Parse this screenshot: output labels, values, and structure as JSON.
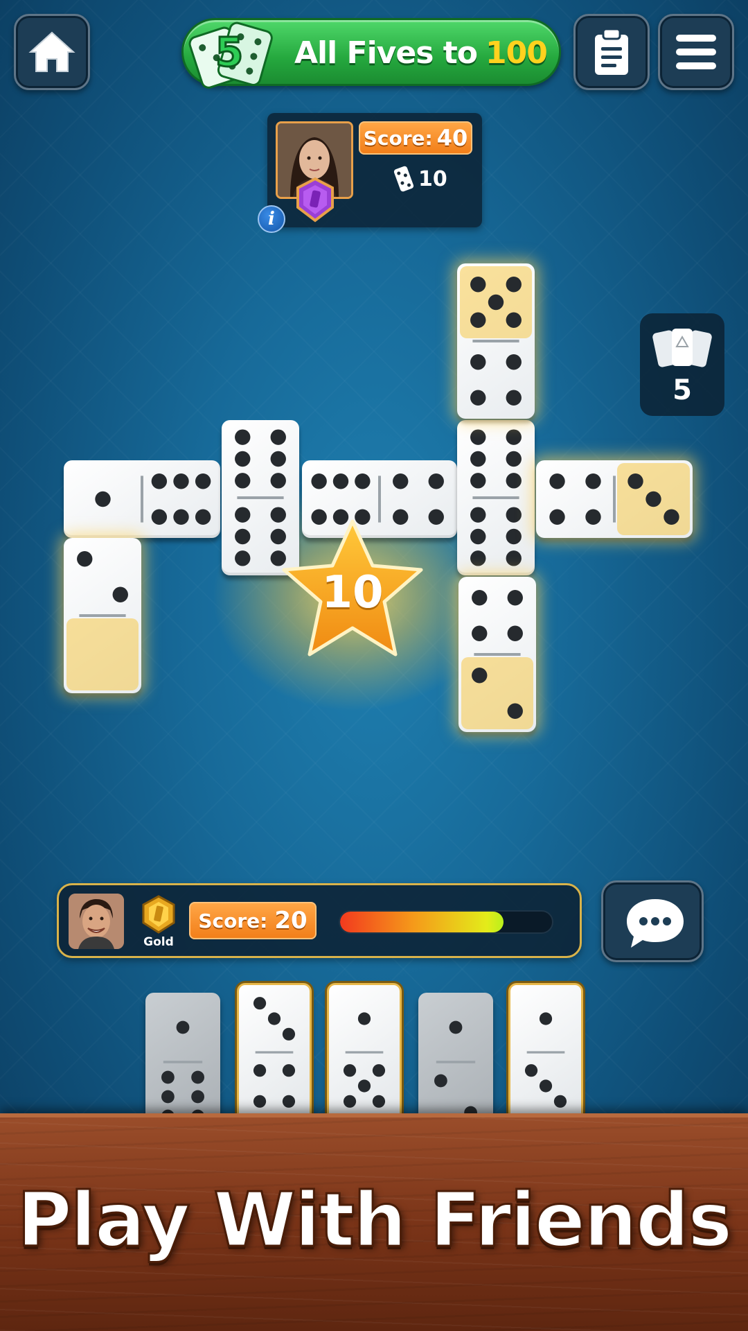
{
  "header": {
    "mode_title": "All Fives to",
    "target_score": "100",
    "logo_badge": "5",
    "home_icon": "home-icon",
    "scores_icon": "clipboard-icon",
    "menu_icon": "hamburger-menu-icon"
  },
  "opponent": {
    "score_label": "Score:",
    "score": "40",
    "tiles_left": "10",
    "rank_badge_icon": "purple-shield-badge-icon",
    "info_icon_text": "i"
  },
  "boneyard": {
    "count": "5",
    "icon": "cards-stack-icon"
  },
  "score_popup": {
    "points": "10"
  },
  "player": {
    "rank": "Gold",
    "score_label": "Score:",
    "score": "20",
    "turn_timer_fraction": 0.77
  },
  "chat": {
    "icon": "chat-bubble-icon"
  },
  "board_tiles": [
    {
      "a": 1,
      "b": 6,
      "orient": "h"
    },
    {
      "a": 2,
      "b": 0,
      "orient": "v",
      "highlight": "b"
    },
    {
      "a": 6,
      "b": 6,
      "orient": "v"
    },
    {
      "a": 6,
      "b": 4,
      "orient": "h"
    },
    {
      "a": 6,
      "b": 6,
      "orient": "v"
    },
    {
      "a": 5,
      "b": 4,
      "orient": "v",
      "highlight": "a"
    },
    {
      "a": 4,
      "b": 2,
      "orient": "v",
      "highlight": "b"
    },
    {
      "a": 4,
      "b": 3,
      "orient": "h",
      "highlight": "b"
    }
  ],
  "hand_tiles": [
    {
      "a": 1,
      "b": 6,
      "playable": false
    },
    {
      "a": 3,
      "b": 4,
      "playable": true
    },
    {
      "a": 1,
      "b": 5,
      "playable": true
    },
    {
      "a": 1,
      "b": 2,
      "playable": false
    },
    {
      "a": 1,
      "b": 3,
      "playable": true
    }
  ],
  "banner": {
    "text": "Play With Friends"
  },
  "colors": {
    "table": "#176a99",
    "accent_green": "#25a83e",
    "accent_orange": "#f27f1a",
    "gold": "#ffd21e",
    "wood": "#7a3418"
  }
}
